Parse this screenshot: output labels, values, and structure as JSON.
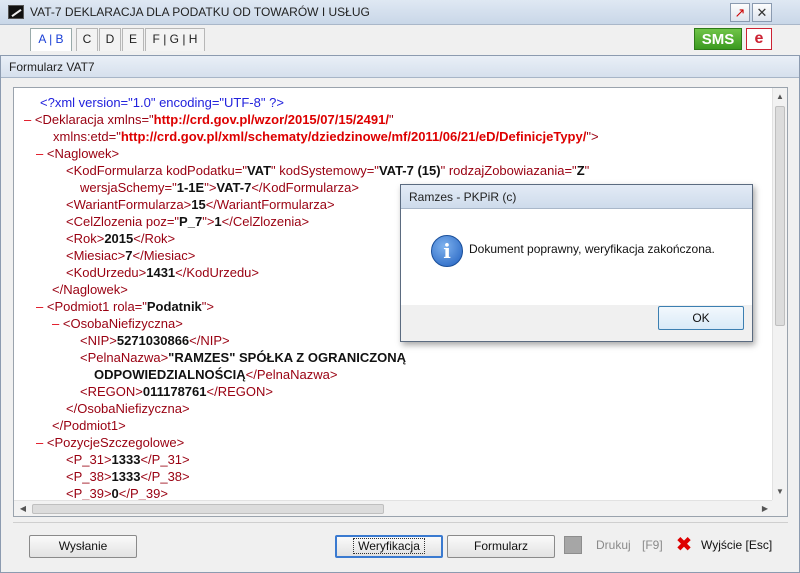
{
  "window": {
    "title": "VAT-7 DEKLARACJA DLA PODATKU OD TOWARÓW I USŁUG",
    "minimize_glyph": "↗",
    "close_glyph": "✕"
  },
  "tabs": [
    {
      "label": "A | B",
      "active": true
    },
    {
      "label": "C"
    },
    {
      "label": "D"
    },
    {
      "label": "E"
    },
    {
      "label": "F | G | H"
    }
  ],
  "badges": {
    "sms": "SMS",
    "e": "e"
  },
  "form": {
    "title": "Formularz VAT7"
  },
  "xml": {
    "pi": "<?xml version=\"1.0\" encoding=\"UTF-8\" ?>",
    "dash": "–",
    "deklaracja_tag": "<Deklaracja",
    "xmlns_attr": "xmlns=\"",
    "xmlns_val": "http://crd.gov.pl/wzor/2015/07/15/2491/",
    "xmlns_etd_attr": "xmlns:etd=\"",
    "xmlns_etd_val": "http://crd.gov.pl/xml/schematy/dziedzinowe/mf/2011/06/21/eD/DefinicjeTypy/",
    "close_gt": "\">",
    "quote": "\"",
    "naglowek_open": "<Naglowek>",
    "kodformularza_open": "<KodFormularza",
    "kodpodatku_attr": "kodPodatku=\"",
    "kodpodatku_val": "VAT",
    "kodsystemowy_attr": "kodSystemowy=\"",
    "kodsystemowy_val": "VAT-7 (15)",
    "rodzaj_attr": "rodzajZobowiazania=\"",
    "rodzaj_val": "Z",
    "wersja_attr": "wersjaSchemy=\"",
    "wersja_val": "1-1E",
    "kodformularza_text": "VAT-7",
    "kodformularza_close": "</KodFormularza>",
    "wariant_open": "<WariantFormularza>",
    "wariant_val": "15",
    "wariant_close": "</WariantFormularza>",
    "cel_open": "<CelZlozenia",
    "cel_poz_attr": "poz=\"",
    "cel_poz_val": "P_7",
    "cel_val": "1",
    "cel_close": "</CelZlozenia>",
    "rok_open": "<Rok>",
    "rok_val": "2015",
    "rok_close": "</Rok>",
    "miesiac_open": "<Miesiac>",
    "miesiac_val": "7",
    "miesiac_close": "</Miesiac>",
    "kodurzedu_open": "<KodUrzedu>",
    "kodurzedu_val": "1431",
    "kodurzedu_close": "</KodUrzedu>",
    "naglowek_close": "</Naglowek>",
    "podmiot_open": "<Podmiot1",
    "rola_attr": "rola=\"",
    "rola_val": "Podatnik",
    "osoba_open": "<OsobaNiefizyczna>",
    "nip_open": "<NIP>",
    "nip_val": "5271030866",
    "nip_close": "</NIP>",
    "pelna_open": "<PelnaNazwa>",
    "pelna_val_1": "\"RAMZES\" SPÓŁKA Z OGRANICZONĄ",
    "pelna_val_2": "ODPOWIEDZIALNOŚCIĄ",
    "pelna_close": "</PelnaNazwa>",
    "regon_open": "<REGON>",
    "regon_val": "011178761",
    "regon_close": "</REGON>",
    "osoba_close": "</OsobaNiefizyczna>",
    "podmiot_close": "</Podmiot1>",
    "pozycje_open": "<PozycjeSzczegolowe>",
    "p31_open": "<P_31>",
    "p31_val": "1333",
    "p31_close": "</P_31>",
    "p38_open": "<P_38>",
    "p38_val": "1333",
    "p38_close": "</P_38>",
    "p39_open": "<P_39>",
    "p39_val": "0",
    "p39_close": "</P_39>",
    "gt": ">"
  },
  "buttons": {
    "wyslanie": "Wysłanie",
    "weryfikacja": "Weryfikacja",
    "formularz": "Formularz",
    "drukuj": "Drukuj",
    "drukuj_key": "[F9]",
    "wyjscie": "Wyjście [Esc]",
    "exit_glyph": "✖"
  },
  "dialog": {
    "title": "Ramzes - PKPiR (c)",
    "message": "Dokument poprawny, weryfikacja zakończona.",
    "ok": "OK",
    "icon_glyph": "i"
  },
  "scroll_glyphs": {
    "up": "▲",
    "down": "▼",
    "left": "◀",
    "right": "▶"
  }
}
